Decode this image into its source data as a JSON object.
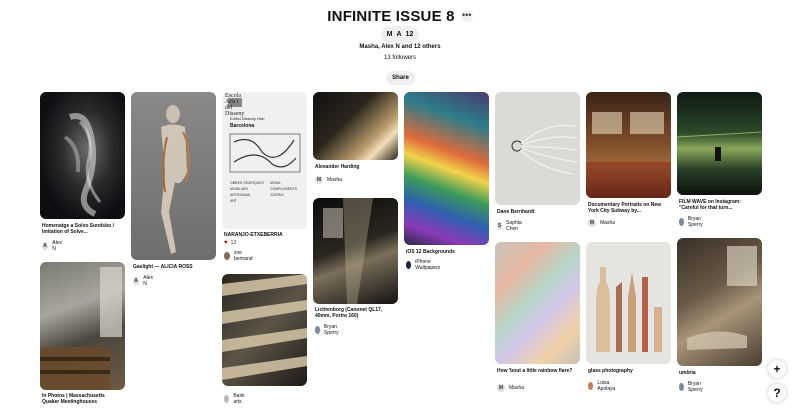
{
  "board": {
    "title": "INFINITE ISSUE 8",
    "more_icon": "ellipsis-icon",
    "collaborators": {
      "initials": [
        "M",
        "A"
      ],
      "count": "12"
    },
    "names_line": "Masha, Alex N and 12 others",
    "followers": "13 followers",
    "share_label": "Share"
  },
  "pins": [
    {
      "caption": "Homenatge a Solvo Sundsbo / Imitation of Solve...",
      "author": "Alex N",
      "avatar": "A"
    },
    {
      "caption": "Gaslight — ALICIA ROSS",
      "author": "Alex N",
      "avatar": "A"
    },
    {
      "caption": "NARANJO-ETXEBERRIA",
      "likes": "13",
      "author": "zoe bertrand",
      "avatar": ""
    },
    {
      "caption": "Alexander Harding",
      "author": "Masha",
      "avatar": "M"
    },
    {
      "caption": "iOS 12 Backgrounds",
      "author": "iPhone Wallpapers",
      "avatar": ""
    },
    {
      "caption": "Dane Bernhardt",
      "author": "Sophia Chen",
      "avatar": "S"
    },
    {
      "caption": "Documentary Portraits on New York City Subway by...",
      "author": "Masha",
      "avatar": "M"
    },
    {
      "caption": "FILM WAVE on Instagram: \"Careful for that turn...",
      "author": "Bryan Sperry",
      "avatar": ""
    },
    {
      "caption": "In Photos | Massachusetts Quaker Meetinghouses",
      "author": "",
      "avatar": ""
    },
    {
      "caption": "Lichtenborg (Canonet QL17, 40mm, Portra 160)",
      "author": "Bryan Sperry",
      "avatar": ""
    },
    {
      "caption": "",
      "author": "Bank arts",
      "avatar": ""
    },
    {
      "caption": "How 'bout a little rainbow flare?",
      "author": "Masha",
      "avatar": "M"
    },
    {
      "caption": "glass photography",
      "author": "Luisa Apolaya",
      "avatar": ""
    },
    {
      "caption": "umbria",
      "author": "Bryan Sperry",
      "avatar": ""
    }
  ],
  "poster": {
    "header": "Escola Arts i del Disseny",
    "line1": "Edifici Disseny Hub",
    "line2": "Barcelona",
    "tags": [
      "OBRES GRÀFIQUES",
      "MOBILIARI",
      "ARTESANIA",
      "ART",
      "MODA",
      "COMPLEMENTS",
      "JOIERIA"
    ]
  },
  "fab": {
    "add_label": "+",
    "help_label": "?"
  }
}
